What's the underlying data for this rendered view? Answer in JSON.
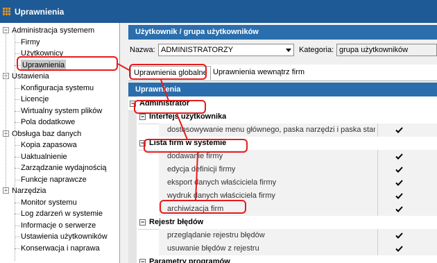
{
  "title": "Uprawnienia",
  "tree": [
    {
      "label": "Administracja systemem",
      "level": 0,
      "expanded": true
    },
    {
      "label": "Firmy",
      "level": 1
    },
    {
      "label": "Użytkownicy",
      "level": 1
    },
    {
      "label": "Uprawnienia",
      "level": 1,
      "selected": true
    },
    {
      "label": "Ustawienia",
      "level": 0,
      "expanded": true
    },
    {
      "label": "Konfiguracja systemu",
      "level": 1
    },
    {
      "label": "Licencje",
      "level": 1
    },
    {
      "label": "Wirtualny system plików",
      "level": 1
    },
    {
      "label": "Pola dodatkowe",
      "level": 1
    },
    {
      "label": "Obsługa baz danych",
      "level": 0,
      "expanded": true
    },
    {
      "label": "Kopia zapasowa",
      "level": 1
    },
    {
      "label": "Uaktualnienie",
      "level": 1
    },
    {
      "label": "Zarządzanie wydajnością",
      "level": 1
    },
    {
      "label": "Funkcje naprawcze",
      "level": 1
    },
    {
      "label": "Narzędzia",
      "level": 0,
      "expanded": true
    },
    {
      "label": "Monitor systemu",
      "level": 1
    },
    {
      "label": "Log zdarzeń w systemie",
      "level": 1
    },
    {
      "label": "Informacje o serwerze",
      "level": 1
    },
    {
      "label": "Ustawienia użytkowników",
      "level": 1
    },
    {
      "label": "Konserwacja i naprawa",
      "level": 1
    }
  ],
  "user_section": {
    "header": "Użytkownik / grupa użytkowników",
    "name_label": "Nazwa:",
    "name_value": "ADMINISTRATORZY",
    "category_label": "Kategoria:",
    "category_value": "grupa użytkowników"
  },
  "tabs": [
    {
      "label": "Uprawnienia globalne",
      "active": true
    },
    {
      "label": "Uprawnienia wewnątrz firm",
      "active": false
    }
  ],
  "permissions": {
    "header": "Uprawnienia",
    "rows": [
      {
        "label": "Administrator",
        "type": "cat",
        "level": 0
      },
      {
        "label": "Interfejs użytkownika",
        "type": "cat",
        "level": 1
      },
      {
        "label": "dostosowywanie menu głównego, paska narzędzi i paska stan",
        "type": "item",
        "checked": true
      },
      {
        "label": "Lista firm w systemie",
        "type": "cat",
        "level": 1
      },
      {
        "label": "dodawanie firmy",
        "type": "item",
        "checked": true
      },
      {
        "label": "edycja definicji firmy",
        "type": "item",
        "checked": true
      },
      {
        "label": "eksport danych właściciela firmy",
        "type": "item",
        "checked": true
      },
      {
        "label": "wydruk danych właściciela firmy",
        "type": "item",
        "checked": true
      },
      {
        "label": "archiwizacja firm",
        "type": "item",
        "checked": true
      },
      {
        "label": "Rejestr błędów",
        "type": "cat",
        "level": 1
      },
      {
        "label": "przeglądanie rejestru błędów",
        "type": "item",
        "checked": true
      },
      {
        "label": "usuwanie błędów z rejestru",
        "type": "item",
        "checked": true
      },
      {
        "label": "Parametry programów",
        "type": "cat",
        "level": 1
      }
    ]
  },
  "colors": {
    "titlebar": "#1e5a96",
    "header": "#2a6ead",
    "annotation": "#e8191a"
  }
}
